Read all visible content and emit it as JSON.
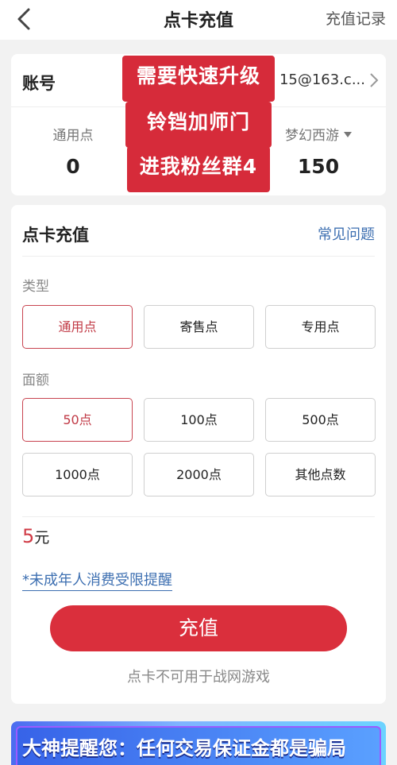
{
  "nav": {
    "title": "点卡充值",
    "right_link": "充值记录"
  },
  "account": {
    "label": "账号",
    "value": "15@163.c...",
    "stats": [
      {
        "label": "通用点",
        "value": "0"
      },
      {
        "label": "梦幻西游",
        "value": "150"
      }
    ]
  },
  "overlay": {
    "lines": [
      "需要快速升级",
      "铃铛加师门",
      "进我粉丝群4"
    ]
  },
  "recharge": {
    "title": "点卡充值",
    "faq": "常见问题",
    "type_label": "类型",
    "types": [
      {
        "label": "通用点",
        "selected": true
      },
      {
        "label": "寄售点",
        "selected": false
      },
      {
        "label": "专用点",
        "selected": false
      }
    ],
    "amount_label": "面额",
    "amounts": [
      {
        "label": "50点",
        "selected": true
      },
      {
        "label": "100点",
        "selected": false
      },
      {
        "label": "500点",
        "selected": false
      },
      {
        "label": "1000点",
        "selected": false
      },
      {
        "label": "2000点",
        "selected": false
      },
      {
        "label": "其他点数",
        "selected": false
      }
    ],
    "price": "5",
    "price_unit": "元",
    "minor_notice": "*未成年人消费受限提醒",
    "button": "充值",
    "note": "点卡不可用于战网游戏"
  },
  "banner": {
    "text": "大神提醒您：任何交易保证金都是骗局"
  },
  "colors": {
    "accent": "#da2f3c",
    "link": "#3d6fb1"
  }
}
